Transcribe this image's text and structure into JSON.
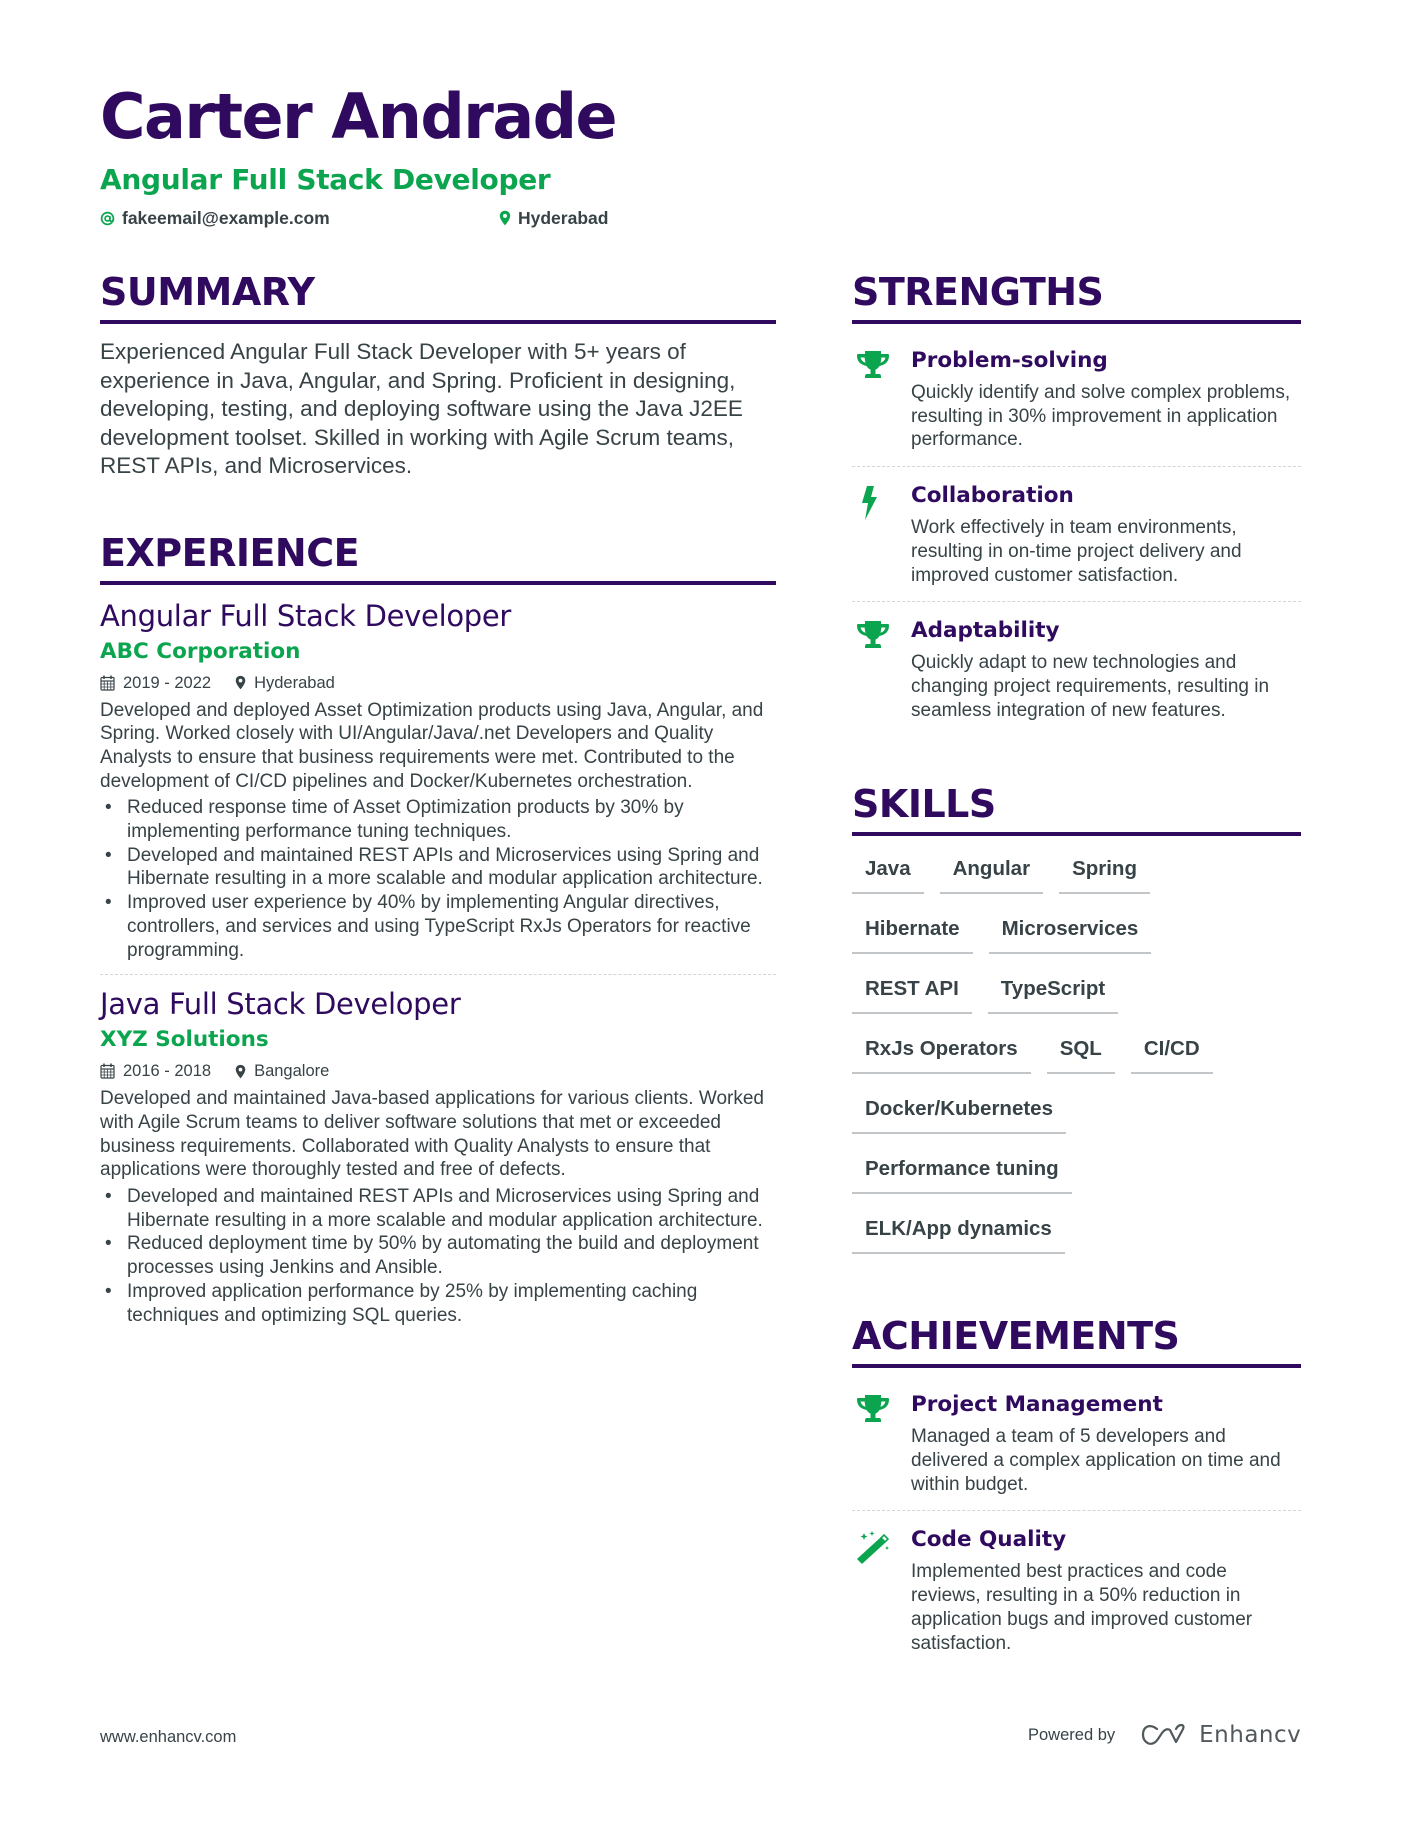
{
  "header": {
    "name": "Carter Andrade",
    "title": "Angular Full Stack Developer",
    "email": "fakeemail@example.com",
    "location": "Hyderabad",
    "email_icon": "at-icon",
    "location_icon": "map-pin-icon"
  },
  "colors": {
    "primary": "#2f0a5f",
    "accent": "#0ca54f",
    "text": "#384347"
  },
  "summary": {
    "heading": "SUMMARY",
    "text": "Experienced Angular Full Stack Developer with 5+ years of experience in Java, Angular, and Spring. Proficient in designing, developing, testing, and deploying software using the Java J2EE development toolset. Skilled in working with Agile Scrum teams, REST APIs, and Microservices."
  },
  "experience": {
    "heading": "EXPERIENCE",
    "items": [
      {
        "role": "Angular Full Stack Developer",
        "company": "ABC Corporation",
        "dates": "2019 - 2022",
        "location": "Hyderabad",
        "description": "Developed and deployed Asset Optimization products using Java, Angular, and Spring. Worked closely with UI/Angular/Java/.net Developers and Quality Analysts to ensure that business requirements were met. Contributed to the development of CI/CD pipelines and Docker/Kubernetes orchestration.",
        "bullets": [
          "Reduced response time of Asset Optimization products by 30% by implementing performance tuning techniques.",
          "Developed and maintained REST APIs and Microservices using Spring and Hibernate resulting in a more scalable and modular application architecture.",
          "Improved user experience by 40% by implementing Angular directives, controllers, and services and using TypeScript RxJs Operators for reactive programming."
        ]
      },
      {
        "role": "Java Full Stack Developer",
        "company": "XYZ Solutions",
        "dates": "2016 - 2018",
        "location": "Bangalore",
        "description": "Developed and maintained Java-based applications for various clients. Worked with Agile Scrum teams to deliver software solutions that met or exceeded business requirements. Collaborated with Quality Analysts to ensure that applications were thoroughly tested and free of defects.",
        "bullets": [
          "Developed and maintained REST APIs and Microservices using Spring and Hibernate resulting in a more scalable and modular application architecture.",
          "Reduced deployment time by 50% by automating the build and deployment processes using Jenkins and Ansible.",
          "Improved application performance by 25% by implementing caching techniques and optimizing SQL queries."
        ]
      }
    ]
  },
  "strengths": {
    "heading": "STRENGTHS",
    "items": [
      {
        "icon": "trophy-icon",
        "title": "Problem-solving",
        "description": "Quickly identify and solve complex problems, resulting in 30% improvement in application performance."
      },
      {
        "icon": "lightning-bolt-icon",
        "title": "Collaboration",
        "description": "Work effectively in team environments, resulting in on-time project delivery and improved customer satisfaction."
      },
      {
        "icon": "trophy-icon",
        "title": "Adaptability",
        "description": "Quickly adapt to new technologies and changing project requirements, resulting in seamless integration of new features."
      }
    ]
  },
  "skills": {
    "heading": "SKILLS",
    "items": [
      "Java",
      "Angular",
      "Spring",
      "Hibernate",
      "Microservices",
      "REST API",
      "TypeScript",
      "RxJs Operators",
      "SQL",
      "CI/CD",
      "Docker/Kubernetes",
      "Performance tuning",
      "ELK/App dynamics"
    ]
  },
  "achievements": {
    "heading": "ACHIEVEMENTS",
    "items": [
      {
        "icon": "trophy-icon",
        "title": "Project Management",
        "description": "Managed a team of 5 developers and delivered a complex application on time and within budget."
      },
      {
        "icon": "magic-wand-icon",
        "title": "Code Quality",
        "description": "Implemented best practices and code reviews, resulting in a 50% reduction in application bugs and improved customer satisfaction."
      }
    ]
  },
  "footer": {
    "website": "www.enhancv.com",
    "powered_by": "Powered by",
    "brand": "Enhancv"
  }
}
